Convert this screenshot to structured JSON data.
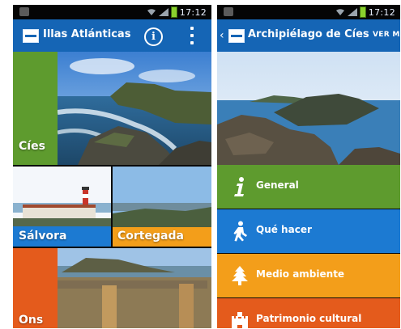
{
  "status_bar": {
    "time": "17:12"
  },
  "left_screen": {
    "app_title": "Illas Atlánticas",
    "tiles": [
      {
        "label": "Cíes",
        "accent": "#5e9b2e"
      },
      {
        "label": "Sálvora",
        "accent": "#1c7ad2"
      },
      {
        "label": "Cortegada",
        "accent": "#f39e1a"
      },
      {
        "label": "Ons",
        "accent": "#e45b1c"
      }
    ]
  },
  "right_screen": {
    "title": "Archipiélago de Cíes",
    "action_label": "VER MA",
    "menu": [
      {
        "label": "General",
        "icon": "info-icon",
        "color": "#5e9b2e"
      },
      {
        "label": "Qué hacer",
        "icon": "hiker-icon",
        "color": "#1c7ad2"
      },
      {
        "label": "Medio ambiente",
        "icon": "tree-icon",
        "color": "#f39e1a"
      },
      {
        "label": "Patrimonio cultural",
        "icon": "castle-icon",
        "color": "#e45b1c"
      }
    ]
  },
  "colors": {
    "app_bar": "#1565b5",
    "status_bar": "#050505"
  }
}
